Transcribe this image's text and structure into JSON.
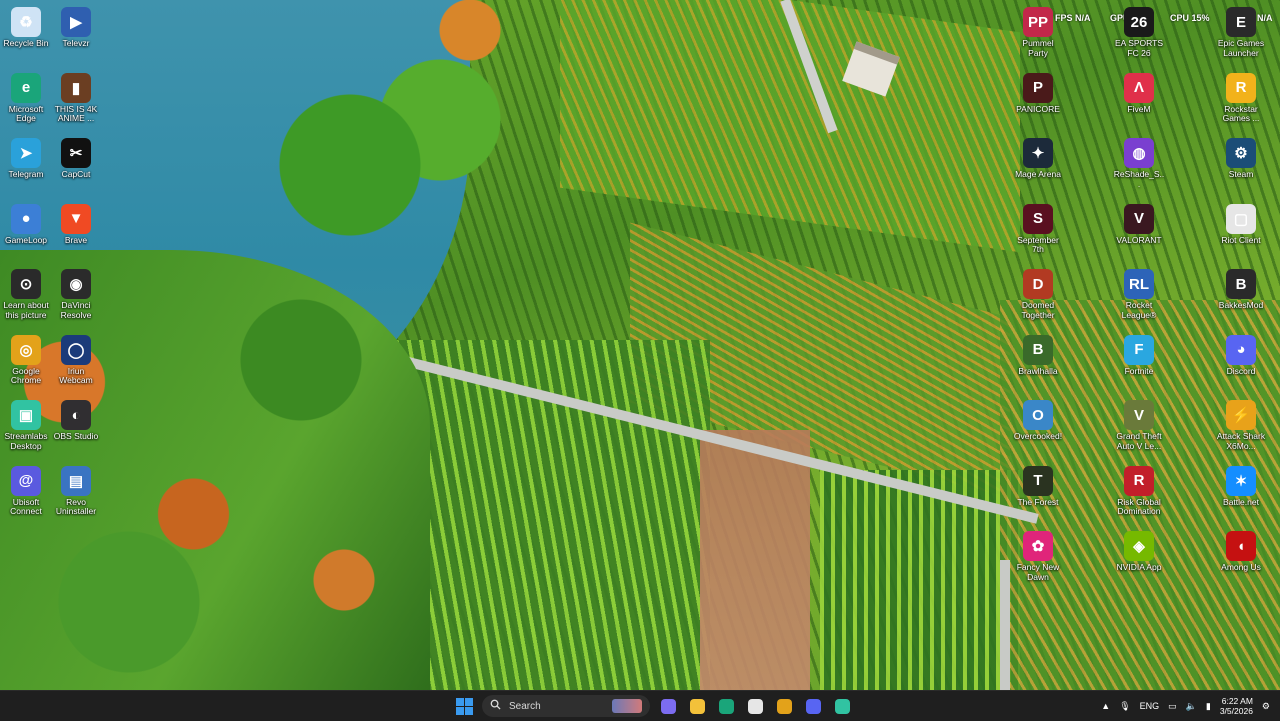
{
  "overlay": {
    "fps": "FPS N/A",
    "gpu": "GPU 3%",
    "cpu": "CPU 15%",
    "gpu2": "N/A"
  },
  "icons_left": [
    {
      "label": "Recycle Bin",
      "icon": "recycle-bin-icon",
      "color": "#cfe3f5",
      "glyph": "♻"
    },
    {
      "label": "Televzr",
      "icon": "televzr-icon",
      "color": "#2f5fb0",
      "glyph": "▶"
    },
    {
      "label": "Microsoft Edge",
      "icon": "edge-icon",
      "color": "#1aa57a",
      "glyph": "e"
    },
    {
      "label": "THIS IS 4K ANIME ...",
      "icon": "video-file-icon",
      "color": "#6b3e22",
      "glyph": "▮"
    },
    {
      "label": "Telegram",
      "icon": "telegram-icon",
      "color": "#2aa1da",
      "glyph": "➤"
    },
    {
      "label": "CapCut",
      "icon": "capcut-icon",
      "color": "#111111",
      "glyph": "✂"
    },
    {
      "label": "GameLoop",
      "icon": "gameloop-icon",
      "color": "#3c7fd6",
      "glyph": "●"
    },
    {
      "label": "Brave",
      "icon": "brave-icon",
      "color": "#f04a23",
      "glyph": "▼"
    },
    {
      "label": "Learn about this picture",
      "icon": "learn-picture-icon",
      "color": "#2a2a2a",
      "glyph": "⊙"
    },
    {
      "label": "DaVinci Resolve",
      "icon": "davinci-icon",
      "color": "#2b2b2b",
      "glyph": "◉"
    },
    {
      "label": "Google Chrome",
      "icon": "chrome-icon",
      "color": "#e3a21a",
      "glyph": "◎"
    },
    {
      "label": "Iriun Webcam",
      "icon": "webcam-icon",
      "color": "#1b3b7a",
      "glyph": "◯"
    },
    {
      "label": "Streamlabs Desktop",
      "icon": "streamlabs-icon",
      "color": "#31c3a2",
      "glyph": "▣"
    },
    {
      "label": "OBS Studio",
      "icon": "obs-icon",
      "color": "#302e31",
      "glyph": "◐"
    },
    {
      "label": "Ubisoft Connect",
      "icon": "ubisoft-icon",
      "color": "#5a5adf",
      "glyph": "@"
    },
    {
      "label": "Revo Uninstaller",
      "icon": "revo-icon",
      "color": "#3a74c2",
      "glyph": "▤"
    }
  ],
  "icons_right": [
    {
      "label": "Pummel Party",
      "icon": "pummel-party-icon",
      "color": "#c2284a",
      "glyph": "PP"
    },
    {
      "label": "EA SPORTS FC 26",
      "icon": "ea-fc-icon",
      "color": "#1a1a1a",
      "glyph": "26"
    },
    {
      "label": "Epic Games Launcher",
      "icon": "epic-games-icon",
      "color": "#2a2a2a",
      "glyph": "E"
    },
    {
      "label": "PANICORE",
      "icon": "panicore-icon",
      "color": "#4a1a1a",
      "glyph": "P"
    },
    {
      "label": "FiveM",
      "icon": "fivem-icon",
      "color": "#e0304a",
      "glyph": "Λ"
    },
    {
      "label": "Rockstar Games ...",
      "icon": "rockstar-icon",
      "color": "#f2b21b",
      "glyph": "R"
    },
    {
      "label": "Mage Arena",
      "icon": "mage-arena-icon",
      "color": "#1c2a3a",
      "glyph": "✦"
    },
    {
      "label": "ReShade_S...",
      "icon": "reshade-icon",
      "color": "#7a3fd0",
      "glyph": "◍"
    },
    {
      "label": "Steam",
      "icon": "steam-icon",
      "color": "#1b4d77",
      "glyph": "⚙"
    },
    {
      "label": "September 7th",
      "icon": "september-icon",
      "color": "#5a1020",
      "glyph": "S"
    },
    {
      "label": "VALORANT",
      "icon": "valorant-icon",
      "color": "#3a1820",
      "glyph": "V"
    },
    {
      "label": "Riot Client",
      "icon": "riot-client-icon",
      "color": "#e6e6e6",
      "glyph": "▢"
    },
    {
      "label": "Doomed Together",
      "icon": "doomed-together-icon",
      "color": "#b23a22",
      "glyph": "D"
    },
    {
      "label": "Rocket League®",
      "icon": "rocket-league-icon",
      "color": "#2d64b8",
      "glyph": "RL"
    },
    {
      "label": "BakkesMod",
      "icon": "bakkesmod-icon",
      "color": "#2a2a2a",
      "glyph": "B"
    },
    {
      "label": "Brawlhalla",
      "icon": "brawlhalla-icon",
      "color": "#3a6a2a",
      "glyph": "B"
    },
    {
      "label": "Fortnite",
      "icon": "fortnite-icon",
      "color": "#2aa7e0",
      "glyph": "F"
    },
    {
      "label": "Discord",
      "icon": "discord-icon",
      "color": "#5865f2",
      "glyph": "◕"
    },
    {
      "label": "Overcooked!",
      "icon": "overcooked-icon",
      "color": "#3a87c8",
      "glyph": "O"
    },
    {
      "label": "Grand Theft Auto V Le...",
      "icon": "gta-icon",
      "color": "#6a7a3a",
      "glyph": "V"
    },
    {
      "label": "Attack Shark X6Mo...",
      "icon": "attack-shark-icon",
      "color": "#e8a21a",
      "glyph": "⚡"
    },
    {
      "label": "The Forest",
      "icon": "the-forest-icon",
      "color": "#2a3320",
      "glyph": "T"
    },
    {
      "label": "Risk Global Domination",
      "icon": "risk-icon",
      "color": "#c21f2a",
      "glyph": "R"
    },
    {
      "label": "Battle.net",
      "icon": "battlenet-icon",
      "color": "#148eff",
      "glyph": "✶"
    },
    {
      "label": "Fancy New Dawn",
      "icon": "far-cry-icon",
      "color": "#e0257a",
      "glyph": "✿"
    },
    {
      "label": "NVIDIA App",
      "icon": "nvidia-icon",
      "color": "#76b900",
      "glyph": "◈"
    },
    {
      "label": "Among Us",
      "icon": "among-us-icon",
      "color": "#c51111",
      "glyph": "◖"
    }
  ],
  "taskbar": {
    "search_label": "Search",
    "apps": [
      {
        "name": "copilot-icon",
        "color": "#7c6cf0"
      },
      {
        "name": "file-explorer-icon",
        "color": "#f3c13a"
      },
      {
        "name": "edge-taskbar-icon",
        "color": "#1aa57a"
      },
      {
        "name": "store-icon",
        "color": "#e6e6e6"
      },
      {
        "name": "chrome-taskbar-icon",
        "color": "#e3a21a"
      },
      {
        "name": "discord-taskbar-icon",
        "color": "#5865f2"
      },
      {
        "name": "streamlabs-taskbar-icon",
        "color": "#31c3a2"
      }
    ],
    "language": "ENG",
    "time": "6:22 AM",
    "date": "3/5/2026"
  }
}
